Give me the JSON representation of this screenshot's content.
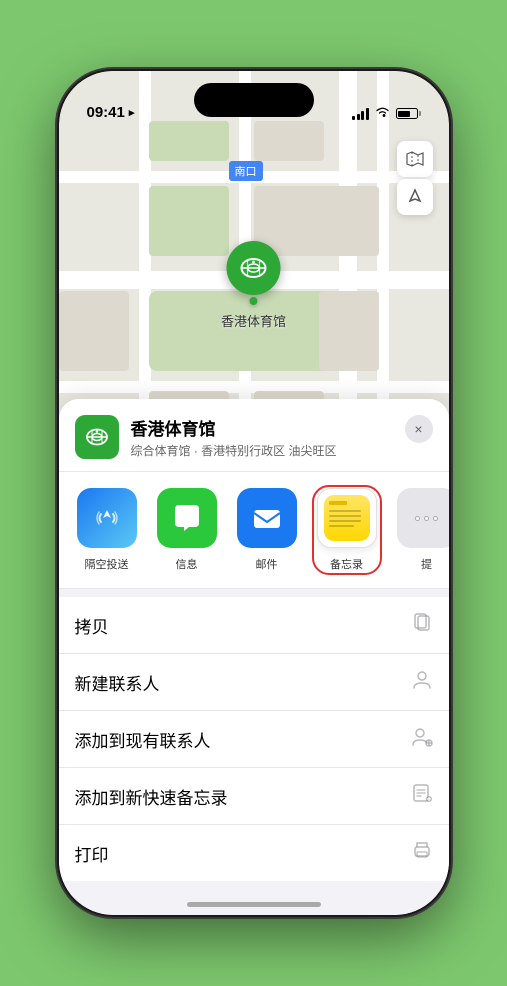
{
  "status_bar": {
    "time": "09:41",
    "location_arrow": "▸"
  },
  "map": {
    "label": "南口",
    "pin_label": "香港体育馆",
    "pin_emoji": "🏟"
  },
  "map_controls": {
    "map_icon": "🗺",
    "location_icon": "↗"
  },
  "venue": {
    "name": "香港体育馆",
    "subtitle": "综合体育馆 · 香港特别行政区 油尖旺区",
    "icon_emoji": "🏟",
    "close_label": "×"
  },
  "share_items": [
    {
      "id": "airdrop",
      "label": "隔空投送",
      "icon_type": "airdrop"
    },
    {
      "id": "messages",
      "label": "信息",
      "icon_type": "messages"
    },
    {
      "id": "mail",
      "label": "邮件",
      "icon_type": "mail"
    },
    {
      "id": "notes",
      "label": "备忘录",
      "icon_type": "notes",
      "selected": true
    },
    {
      "id": "more",
      "label": "提",
      "icon_type": "more"
    }
  ],
  "actions": [
    {
      "id": "copy",
      "label": "拷贝",
      "icon": "copy"
    },
    {
      "id": "new-contact",
      "label": "新建联系人",
      "icon": "person-add"
    },
    {
      "id": "add-existing",
      "label": "添加到现有联系人",
      "icon": "person-circle-plus"
    },
    {
      "id": "quick-note",
      "label": "添加到新快速备忘录",
      "icon": "note-add"
    },
    {
      "id": "print",
      "label": "打印",
      "icon": "print"
    }
  ]
}
